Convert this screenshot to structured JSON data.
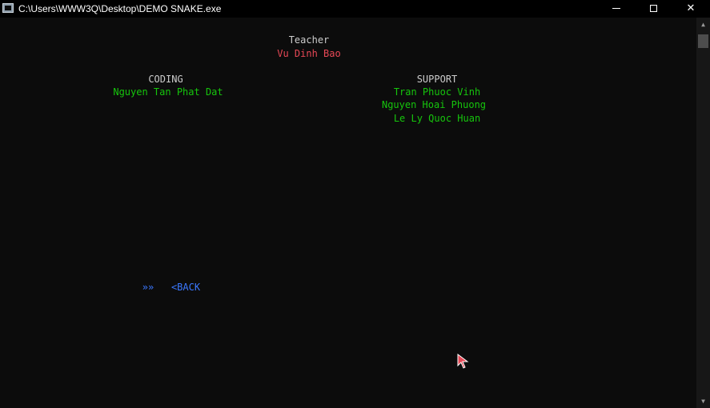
{
  "window": {
    "title": "C:\\Users\\WWW3Q\\Desktop\\DEMO SNAKE.exe",
    "icons": {
      "app": "console-app-icon",
      "minimize": "minimize-icon",
      "maximize": "maximize-icon",
      "close": "close-icon"
    },
    "close_glyph": "✕"
  },
  "credits": {
    "teacher_heading": "Teacher",
    "teacher_name": "Vu Dinh Bao",
    "coding_heading": "CODING",
    "coding_members": [
      "Nguyen Tan Phat Dat"
    ],
    "support_heading": "SUPPORT",
    "support_members": [
      "Tran Phuoc Vinh",
      "Nguyen Hoai Phuong",
      "Le Ly Quoc Huan"
    ]
  },
  "menu": {
    "selector": "»»",
    "back_label": "<BACK"
  },
  "scrollbar": {
    "up_arrow": "▲",
    "down_arrow": "▼"
  },
  "colors": {
    "background": "#0c0c0c",
    "heading": "#cccccc",
    "teacher_name": "#e74856",
    "members": "#16c60c",
    "menu": "#3b78ff",
    "cursor": "#e74856"
  }
}
